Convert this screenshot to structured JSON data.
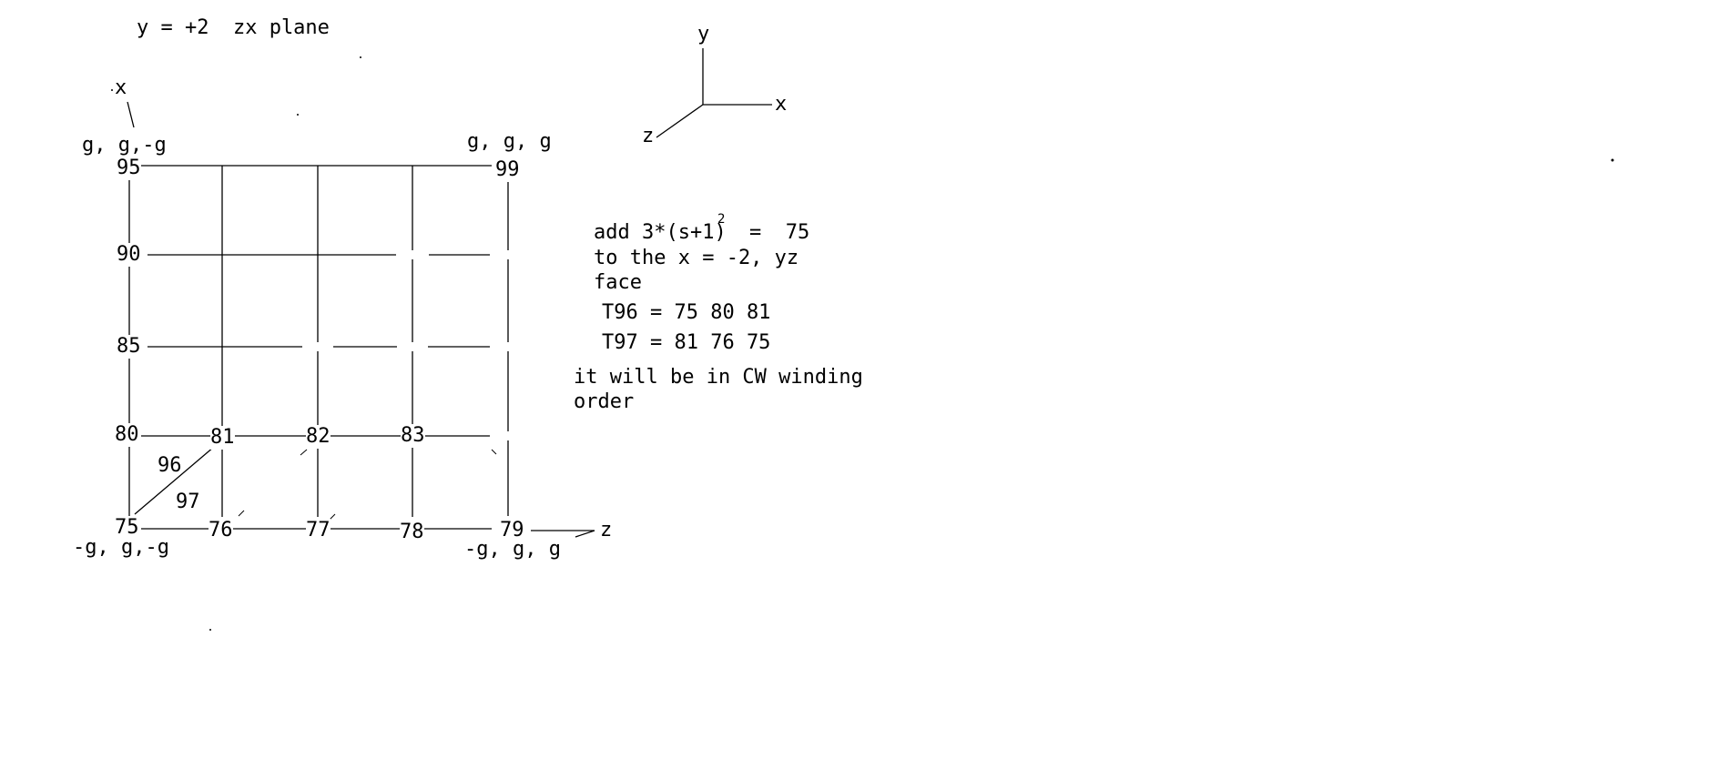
{
  "heading": "y = +2  zx plane",
  "axis_labels": {
    "x": "x",
    "z": "z"
  },
  "corner_labels": {
    "top_left": "g, g,-g",
    "top_right": "g, g, g",
    "bottom_left": "-g, g,-g",
    "bottom_right": "-g, g, g"
  },
  "vertex_labels": {
    "v95": "95",
    "v99": "99",
    "v90": "90",
    "v85": "85",
    "v80": "80",
    "v81": "81",
    "v82": "82",
    "v83": "83",
    "v75": "75",
    "v76": "76",
    "v77": "77",
    "v78": "78",
    "v79": "79"
  },
  "triangle_labels": {
    "t96": "96",
    "t97": "97"
  },
  "axes_gizmo": {
    "y": "y",
    "x": "x",
    "z": "z"
  },
  "notes": {
    "line1": "add 3*(s+1)",
    "superscript": "2",
    "line1_result": "=  75",
    "line2": "to the x = -2, yz",
    "line3": "face",
    "t96_def": "T96 = 75 80 81",
    "t97_def": "T97 = 81 76 75",
    "winding_line1": "it will be in CW winding",
    "winding_line2": "order"
  }
}
